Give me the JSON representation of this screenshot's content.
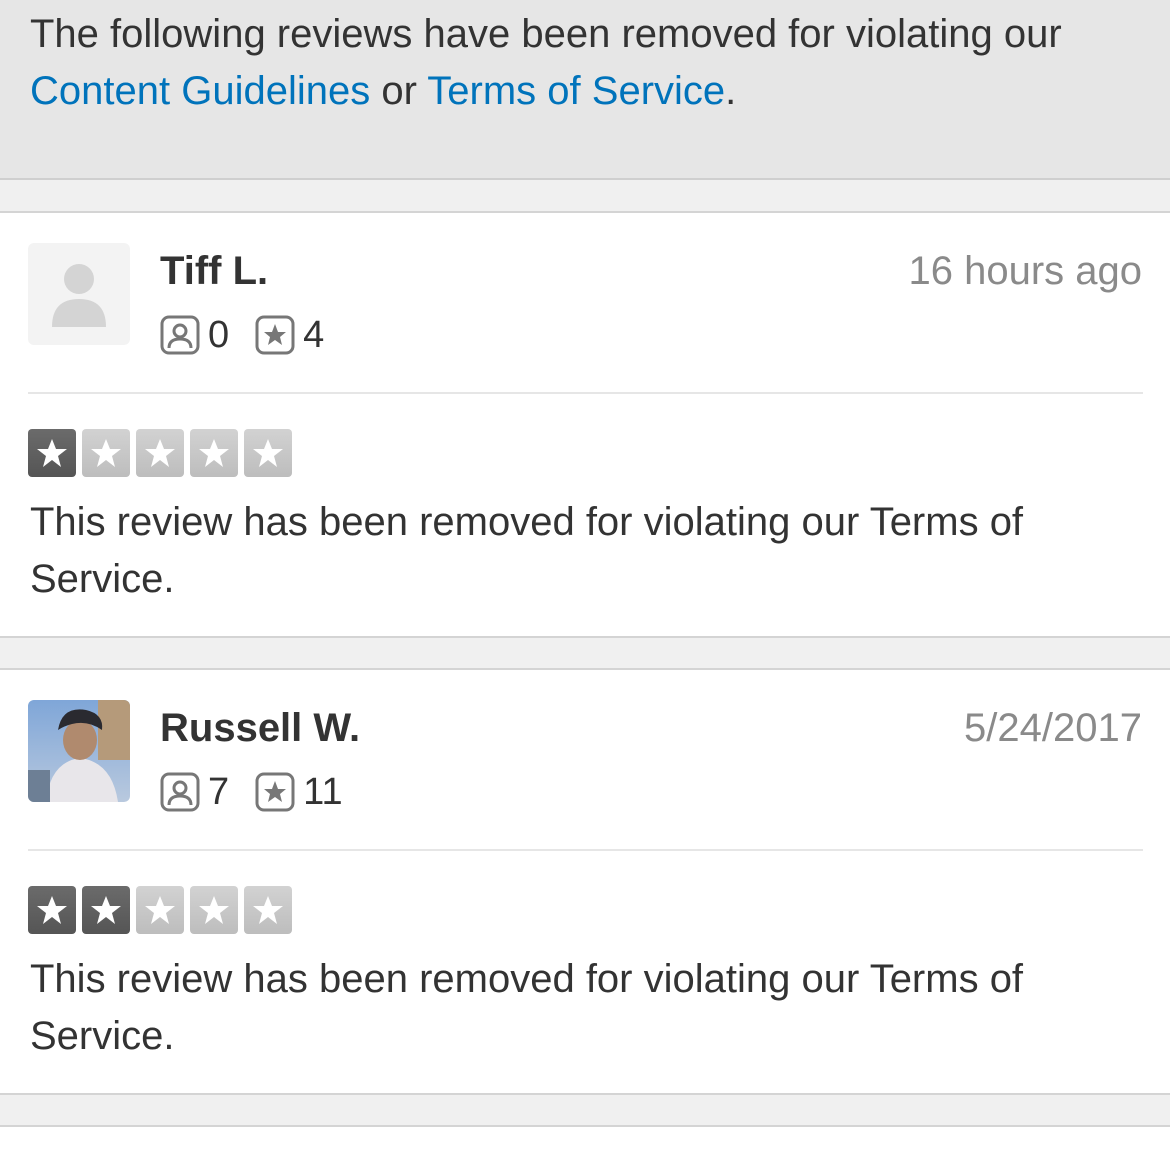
{
  "notice": {
    "text_before": "The following reviews have been removed for violating our ",
    "link_guidelines": "Content Guidelines",
    "text_middle": " or ",
    "link_terms": "Terms of Service",
    "text_after": "."
  },
  "reviews": [
    {
      "name": "Tiff L.",
      "date": "16 hours ago",
      "friends": "0",
      "review_count": "4",
      "rating": 1,
      "rating_max": 5,
      "text": "This review has been removed for violating our Terms of Service.",
      "avatar": "default-user-icon"
    },
    {
      "name": "Russell W.",
      "date": "5/24/2017",
      "friends": "7",
      "review_count": "11",
      "rating": 2,
      "rating_max": 5,
      "text": "This review has been removed for violating our Terms of Service.",
      "avatar": "user-photo"
    }
  ],
  "colors": {
    "link": "#0073bb",
    "star_filled": "#5a5a5a",
    "star_empty": "#c8c8c8",
    "date": "#8a8a8a"
  }
}
